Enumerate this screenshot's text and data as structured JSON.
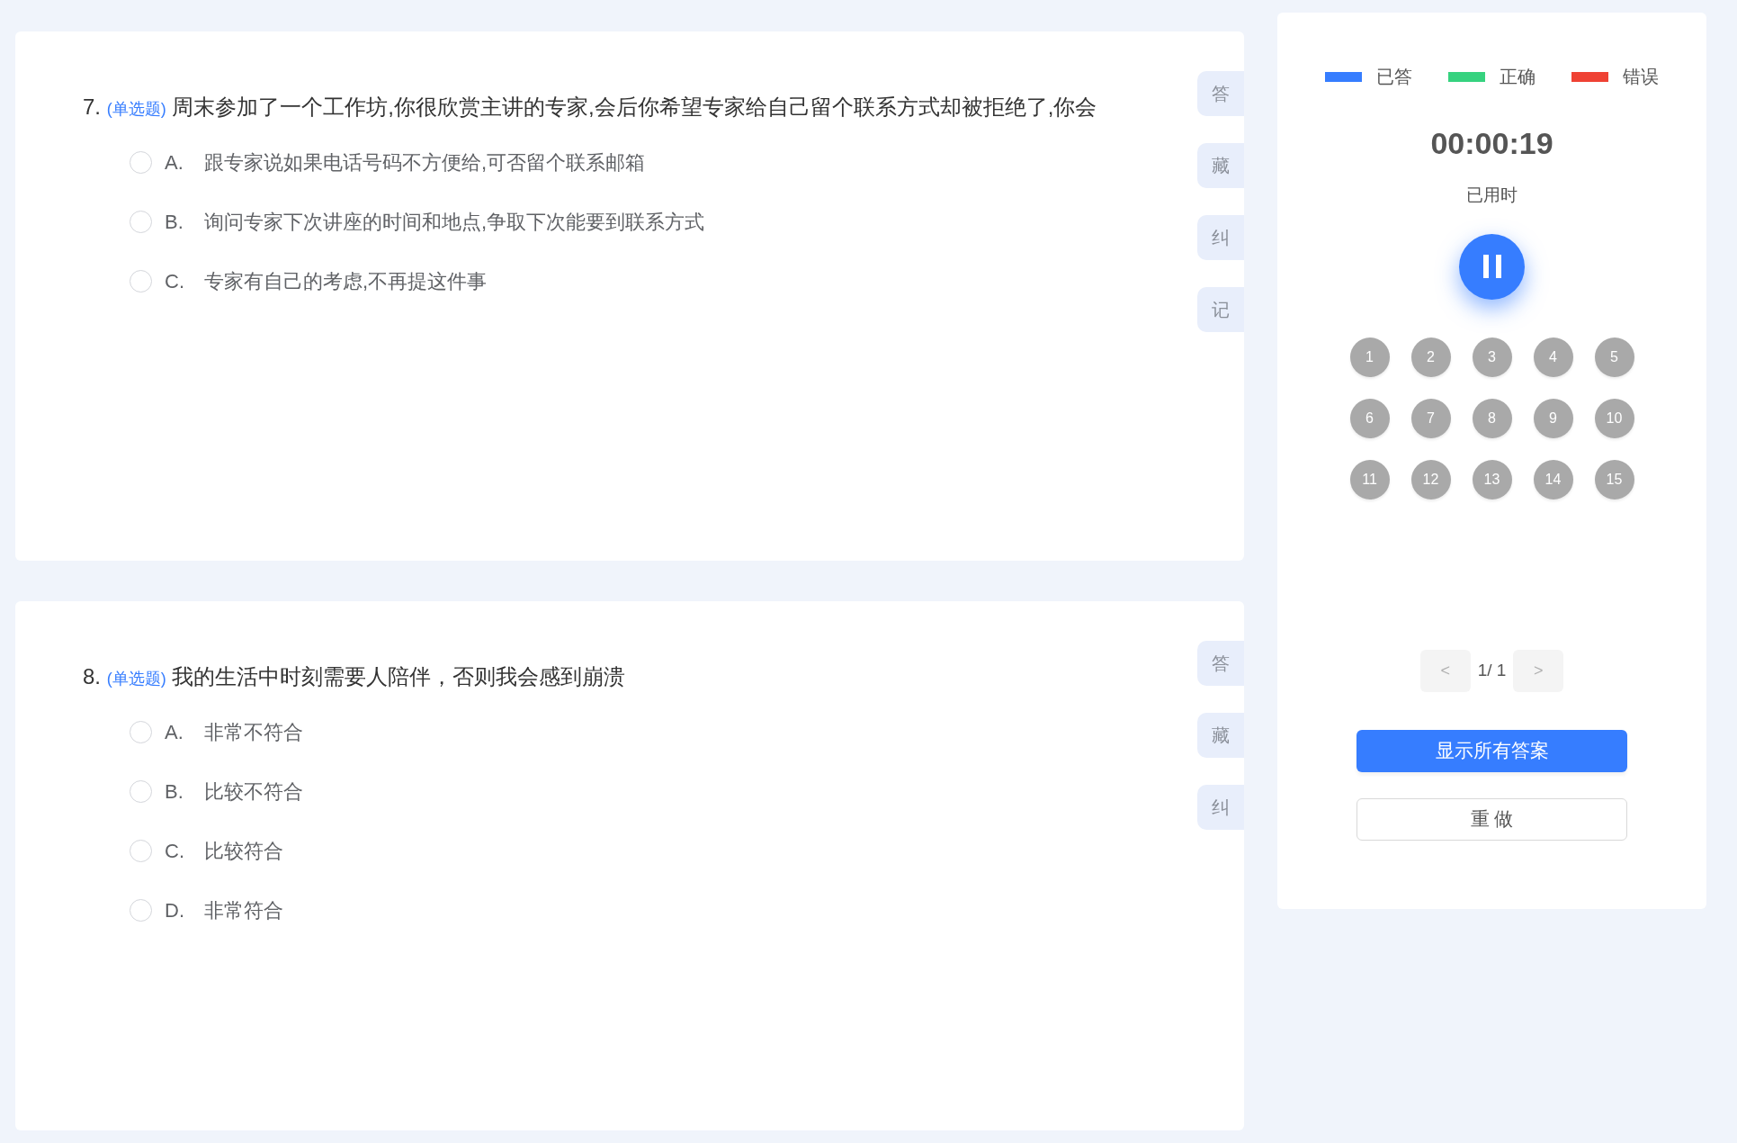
{
  "questions": [
    {
      "number": "7.",
      "type_tag": "(单选题)",
      "text": "周末参加了一个工作坊,你很欣赏主讲的专家,会后你希望专家给自己留个联系方式却被拒绝了,你会",
      "options": [
        {
          "letter": "A.",
          "text": "跟专家说如果电话号码不方便给,可否留个联系邮箱",
          "selected": false
        },
        {
          "letter": "B.",
          "text": "询问专家下次讲座的时间和地点,争取下次能要到联系方式",
          "selected": false
        },
        {
          "letter": "C.",
          "text": "专家有自己的考虑,不再提这件事",
          "selected": false
        }
      ],
      "side_buttons": [
        "答",
        "藏",
        "纠",
        "记"
      ]
    },
    {
      "number": "8.",
      "type_tag": "(单选题)",
      "text": "我的生活中时刻需要人陪伴，否则我会感到崩溃",
      "options": [
        {
          "letter": "A.",
          "text": "非常不符合",
          "selected": false
        },
        {
          "letter": "B.",
          "text": "比较不符合",
          "selected": false
        },
        {
          "letter": "C.",
          "text": "比较符合",
          "selected": false
        },
        {
          "letter": "D.",
          "text": "非常符合",
          "selected": false
        }
      ],
      "side_buttons": [
        "答",
        "藏",
        "纠"
      ]
    }
  ],
  "legend": [
    {
      "label": "已答",
      "color": "#367dff"
    },
    {
      "label": "正确",
      "color": "#36d27f"
    },
    {
      "label": "错误",
      "color": "#ef4234"
    }
  ],
  "timer": {
    "value": "00:00:19",
    "label": "已用时",
    "paused": false
  },
  "answer_sheet": [
    {
      "number": "1",
      "answered": false
    },
    {
      "number": "2",
      "answered": false
    },
    {
      "number": "3",
      "answered": false
    },
    {
      "number": "4",
      "answered": false
    },
    {
      "number": "5",
      "answered": false
    },
    {
      "number": "6",
      "answered": false
    },
    {
      "number": "7",
      "answered": false
    },
    {
      "number": "8",
      "answered": false
    },
    {
      "number": "9",
      "answered": false
    },
    {
      "number": "10",
      "answered": false
    },
    {
      "number": "11",
      "answered": false
    },
    {
      "number": "12",
      "answered": false
    },
    {
      "number": "13",
      "answered": false
    },
    {
      "number": "14",
      "answered": false
    },
    {
      "number": "15",
      "answered": false
    }
  ],
  "pager": {
    "prev": "<",
    "page": "1/ 1",
    "next": ">"
  },
  "buttons": {
    "show_answers": "显示所有答案",
    "redo": "重 做"
  }
}
